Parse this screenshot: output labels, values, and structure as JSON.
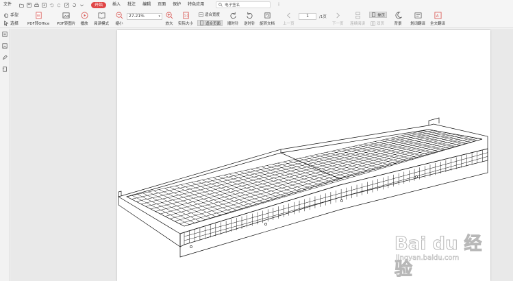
{
  "menu": {
    "file": "文件",
    "start": "开始",
    "insert": "插入",
    "annotate": "批注",
    "edit": "编辑",
    "page": "页面",
    "protect": "保护",
    "features": "特色应用",
    "search_placeholder": "电子签名"
  },
  "toolbar": {
    "hand": "手型",
    "select": "选择",
    "pdf_to_office": "PDF转Office",
    "pdf_to_image": "PDF转图片",
    "play": "播放",
    "read_mode": "阅读模式",
    "zoom_out": "缩小",
    "zoom_value": "27.21%",
    "zoom_in": "放大",
    "actual_size": "实际大小",
    "fit_width": "适合宽度",
    "fit_page": "适合页面",
    "rotate_cw": "顺时针",
    "rotate_ccw": "逆时针",
    "rotate_doc": "旋转文档",
    "prev_page": "上一页",
    "page_current": "1",
    "page_total": "/1页",
    "next_page": "下一页",
    "continuous_read": "连续阅读",
    "single_page": "单页",
    "double_page": "双页",
    "background": "背景",
    "word_translate": "划词翻译",
    "full_translate": "全文翻译"
  },
  "watermark": {
    "logo": "Bai du 经验",
    "url": "jingyan.baidu.com"
  },
  "colors": {
    "accent": "#e04646",
    "toolbar_bg": "#f5f5f5",
    "workarea_bg": "#e9e9e9"
  }
}
